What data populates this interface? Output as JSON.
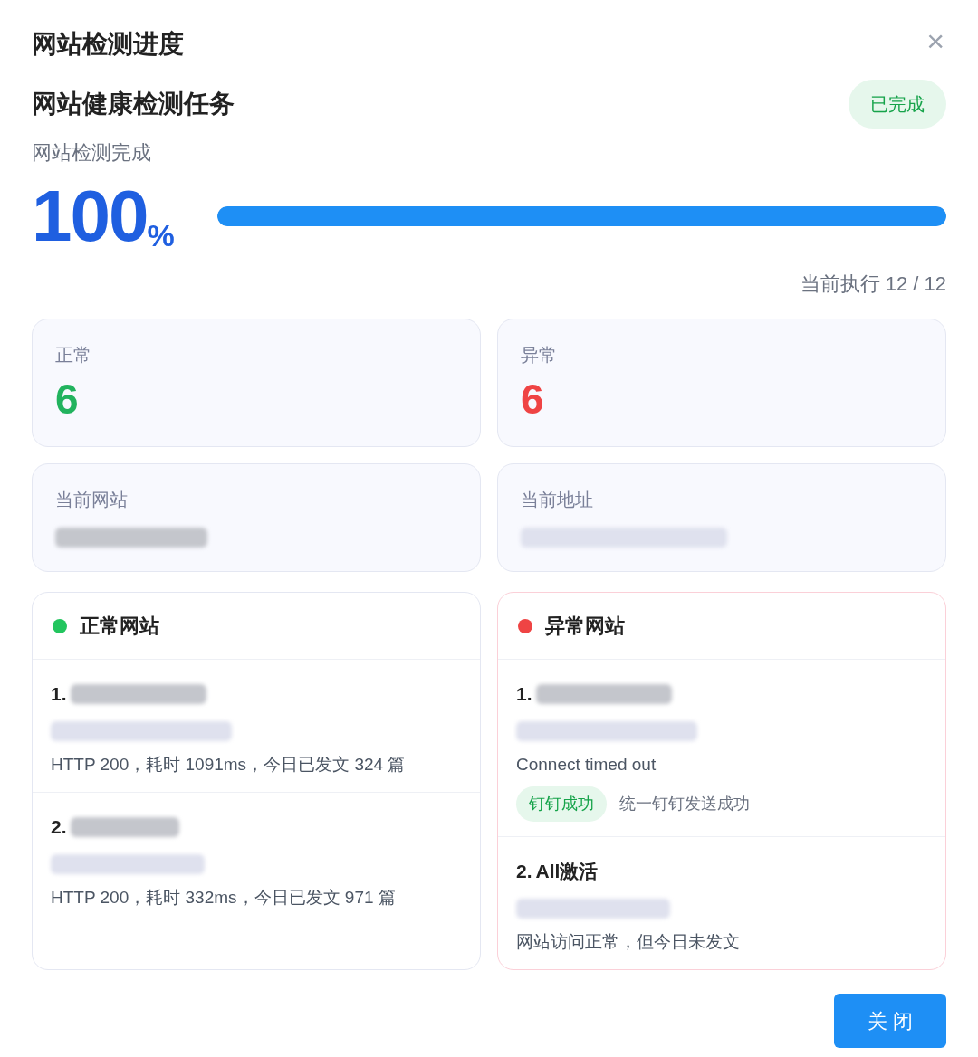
{
  "dialog": {
    "title": "网站检测进度",
    "close_icon": "×"
  },
  "task": {
    "name": "网站健康检测任务",
    "status": {
      "label": "已完成",
      "kind": "done"
    }
  },
  "progress": {
    "caption": "网站检测完成",
    "percent": "100",
    "unit": "%",
    "level": 1,
    "counter": "当前执行 12 / 12"
  },
  "stats": [
    {
      "label": "正常",
      "value": "6",
      "kind": "ok"
    },
    {
      "label": "异常",
      "value": "6",
      "kind": "error"
    }
  ],
  "current": [
    {
      "label": "当前网站",
      "kind": "site"
    },
    {
      "label": "当前地址",
      "kind": "address"
    }
  ],
  "lists": [
    {
      "title": "正常网站",
      "color": "#22c55e",
      "kind": "ok",
      "items": [
        {
          "index": "1.",
          "detail": "HTTP 200，耗时 1091ms，今日已发文 324 篇"
        },
        {
          "index": "2.",
          "detail": "HTTP 200，耗时 332ms，今日已发文 971 篇"
        }
      ]
    },
    {
      "title": "异常网站",
      "color": "#ef4444",
      "kind": "error",
      "items": [
        {
          "index": "1.",
          "detail": "Connect timed out",
          "tag": "钉钉成功",
          "note": "统一钉钉发送成功"
        },
        {
          "index": "2.",
          "name": "All激活",
          "detail": "网站访问正常，但今日未发文"
        }
      ]
    }
  ],
  "close_button": "关 闭"
}
